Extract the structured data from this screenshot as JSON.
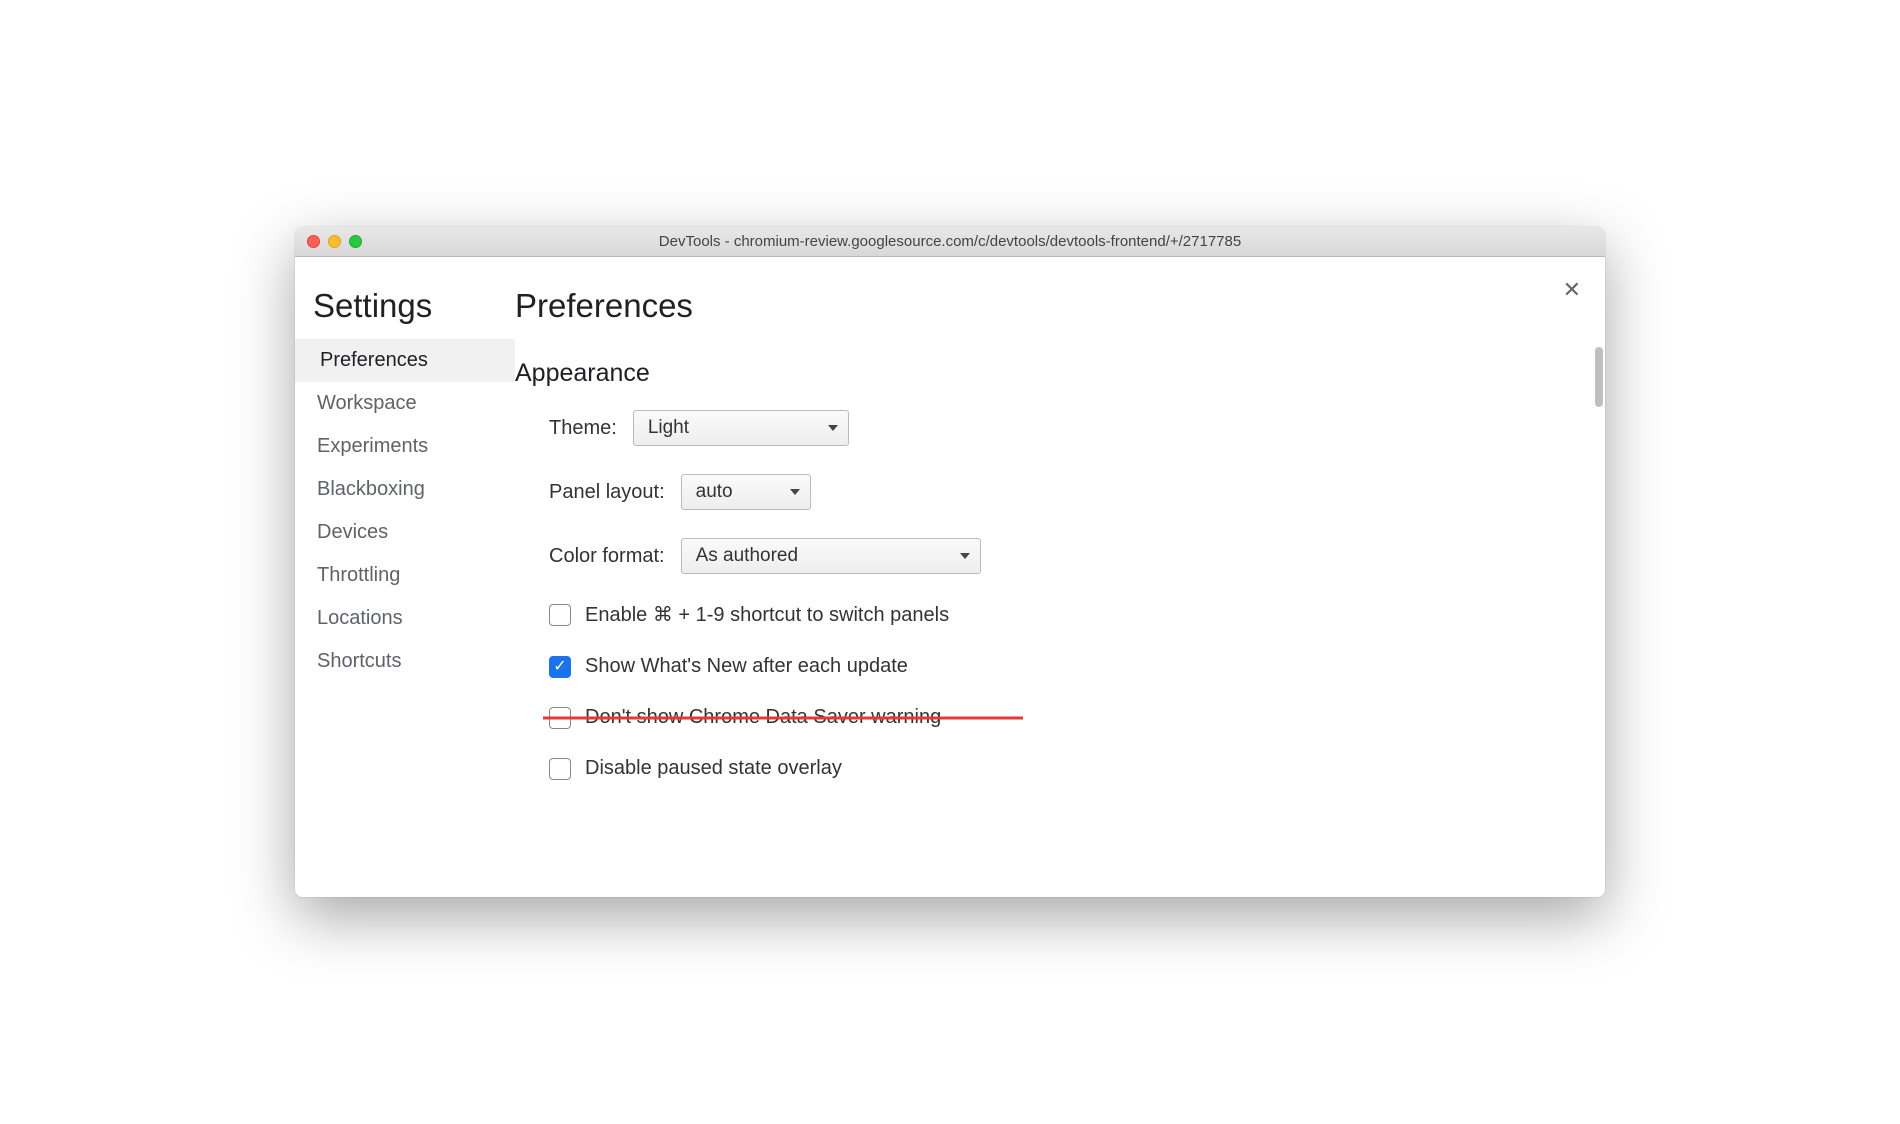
{
  "window": {
    "title": "DevTools - chromium-review.googlesource.com/c/devtools/devtools-frontend/+/2717785"
  },
  "sidebar": {
    "title": "Settings",
    "items": [
      {
        "label": "Preferences",
        "active": true
      },
      {
        "label": "Workspace",
        "active": false
      },
      {
        "label": "Experiments",
        "active": false
      },
      {
        "label": "Blackboxing",
        "active": false
      },
      {
        "label": "Devices",
        "active": false
      },
      {
        "label": "Throttling",
        "active": false
      },
      {
        "label": "Locations",
        "active": false
      },
      {
        "label": "Shortcuts",
        "active": false
      }
    ]
  },
  "main": {
    "title": "Preferences",
    "section": "Appearance",
    "theme_label": "Theme:",
    "theme_value": "Light",
    "panel_label": "Panel layout:",
    "panel_value": "auto",
    "color_label": "Color format:",
    "color_value": "As authored",
    "checks": [
      {
        "label": "Enable ⌘ + 1-9 shortcut to switch panels",
        "checked": false,
        "strike": false
      },
      {
        "label": "Show What's New after each update",
        "checked": true,
        "strike": false
      },
      {
        "label": "Don't show Chrome Data Saver warning",
        "checked": false,
        "strike": true
      },
      {
        "label": "Disable paused state overlay",
        "checked": false,
        "strike": false
      }
    ]
  },
  "close_glyph": "✕"
}
